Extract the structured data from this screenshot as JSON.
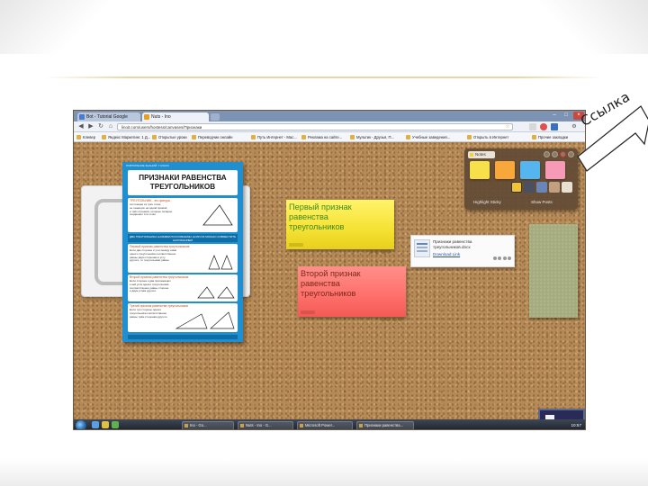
{
  "browser": {
    "tabs": [
      {
        "label": "Bot - Tutorial Google"
      },
      {
        "label": "Nuts - Ino"
      }
    ],
    "url": "linoit.com/users/hostess/canvases/Признаки",
    "bookmarks": [
      "Клевер",
      "Яндекс Маркетинг. 1 Д...",
      "Открытые уроки",
      "Переводчик онлайн",
      "Путь Интернет - Мас...",
      "Реклама на сайте...",
      "Мультик - Друзья, П...",
      "Учебные заведения...",
      "Открыть в Интернет",
      "Прочие закладки"
    ]
  },
  "poster": {
    "header": "ПОВТОРЕНИЕ ЗНАНИЙ: 7 КЛАСС",
    "title": "ПРИЗНАКИ РАВЕНСТВА ТРЕУГОЛЬНИКОВ",
    "section_intro": {
      "heading": "ТРЕУГОЛЬНИК - это фигура,",
      "lines": [
        "состоящая из трёх точек,",
        "не лежащих на одной прямой,",
        "и трёх отрезков, которые попарно",
        "соединяют эти точки"
      ]
    },
    "banner": "ДВА ТРЕУГОЛЬНИКА НАЗЫВАЮТСЯ РАВНЫМИ, ЕСЛИ ИХ МОЖНО СОВМЕСТИТЬ НАЛОЖЕНИЕМ",
    "section_1": {
      "heading": "Первый признак равенства треугольников",
      "lines": [
        "Если две стороны и угол между ними",
        "одного треугольника соответственно",
        "равны двум сторонам и углу",
        "другого, то треугольники равны"
      ]
    },
    "section_2": {
      "heading": "Второй признак равенства треугольников",
      "lines": [
        "Если сторона и два прилежащих",
        "к ней угла одного треугольника",
        "соответственно равны стороне",
        "и двум углам другого"
      ]
    },
    "section_3": {
      "heading": "Третий признак равенства треугольников",
      "lines": [
        "Если три стороны одного",
        "треугольника соответственно",
        "равны трём сторонам другого"
      ]
    }
  },
  "notes": {
    "first": "Первый признак\nравенства\nтреугольников",
    "second": "Второй признак\nравенства\nтреугольников"
  },
  "link_card": {
    "title": "Признаки равенства\nтреугольников.docx",
    "url": "Download Link"
  },
  "palette": {
    "tab_label": "Notes",
    "footer_left": "Highlight Sticky",
    "footer_right": "Show Posts"
  },
  "taskbar": {
    "tasks": [
      "Ino - Go...",
      "Nuts - Ino - G...",
      "Microsoft Power...",
      "Признаки равенства..."
    ],
    "clock": "10:57"
  },
  "callout": {
    "label": "Ссылка"
  },
  "colors": {
    "cork": "#b58a57",
    "yellow_note": "#f5e234",
    "red_note": "#ff6e6a",
    "green_note": "#a4ab7c",
    "poster_blue": "#1f8fcf"
  }
}
